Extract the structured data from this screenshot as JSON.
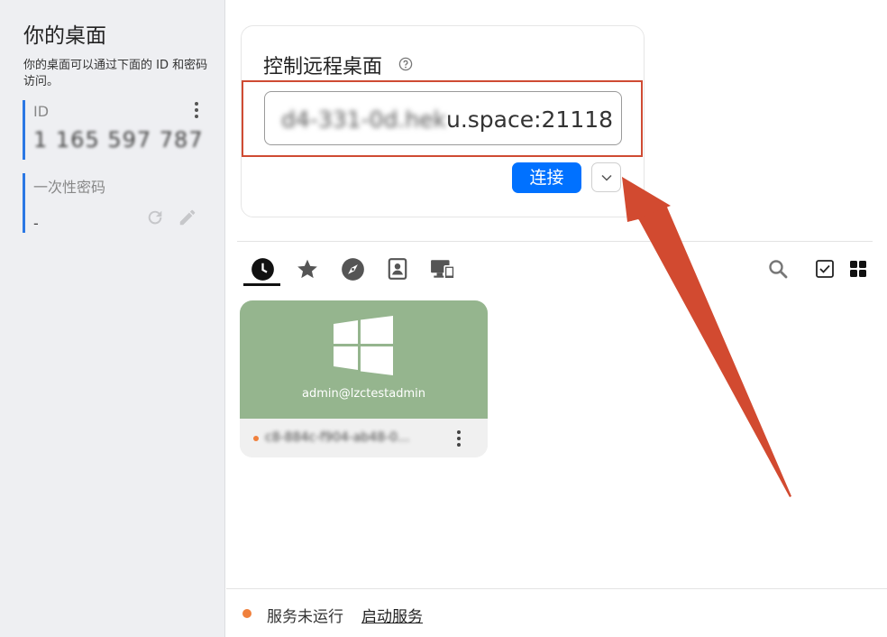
{
  "sidebar": {
    "title": "你的桌面",
    "description": "你的桌面可以通过下面的 ID 和密码访问。",
    "id_label": "ID",
    "id_value": "1 165 597 787",
    "password_label": "一次性密码",
    "password_value": "-",
    "icons": [
      "more-vertical-icon",
      "refresh-icon",
      "edit-icon"
    ]
  },
  "control": {
    "title": "控制远程桌面",
    "remote_value_obscured": "d4-331-0d.hek",
    "remote_value_visible": "u.space:21118",
    "connect_label": "连接",
    "accent_color": "#0071ff",
    "highlight_color": "#cf4b33"
  },
  "tabs": [
    {
      "name": "recent-icon",
      "active": true
    },
    {
      "name": "star-icon",
      "active": false
    },
    {
      "name": "compass-icon",
      "active": false
    },
    {
      "name": "address-book-icon",
      "active": false
    },
    {
      "name": "lan-devices-icon",
      "active": false
    }
  ],
  "toolbar": [
    "search-icon",
    "checkbox-icon",
    "grid-view-icon"
  ],
  "peer": {
    "user": "admin@lzctestadmin",
    "id_obscured": "c8-884c-f904-ab48-0...",
    "os_icon": "windows-logo-icon",
    "tile_color": "#95b58e",
    "status_color": "#f0803c"
  },
  "footer": {
    "status_text": "服务未运行",
    "start_link": "启动服务",
    "status_color": "#f0803c"
  }
}
